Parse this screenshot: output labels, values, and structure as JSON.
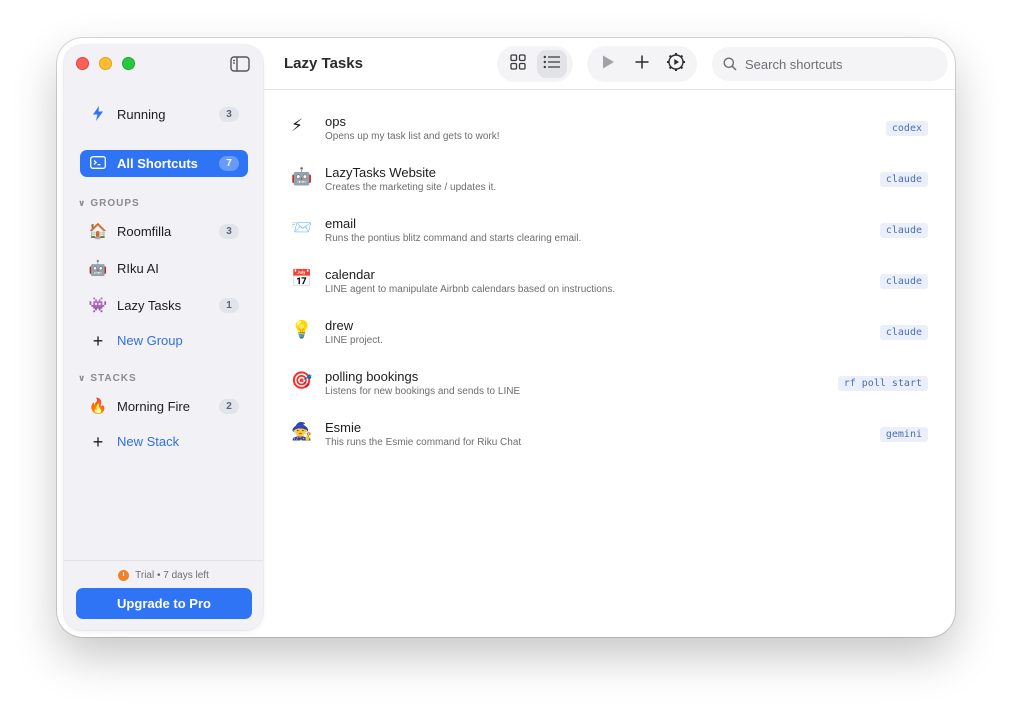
{
  "window": {
    "title": "Lazy Tasks"
  },
  "sidebar": {
    "running": {
      "label": "Running",
      "count": "3"
    },
    "all_shortcuts": {
      "label": "All Shortcuts",
      "count": "7"
    },
    "groups_header": "GROUPS",
    "groups": [
      {
        "emoji": "🏠",
        "label": "Roomfilla",
        "count": "3"
      },
      {
        "emoji": "🤖",
        "label": "RIku AI",
        "count": ""
      },
      {
        "emoji": "👾",
        "label": "Lazy Tasks",
        "count": "1"
      }
    ],
    "new_group": "New Group",
    "stacks_header": "STACKS",
    "stacks": [
      {
        "emoji": "🔥",
        "label": "Morning Fire",
        "count": "2"
      }
    ],
    "new_stack": "New Stack",
    "trial": "Trial • 7 days left",
    "upgrade": "Upgrade to Pro"
  },
  "toolbar": {
    "search_placeholder": "Search shortcuts",
    "view_mode": "list"
  },
  "shortcuts": [
    {
      "emoji": "⚡",
      "name": "ops",
      "desc": "Opens up my task list and gets to work!",
      "tag": "codex"
    },
    {
      "emoji": "🤖",
      "name": "LazyTasks Website",
      "desc": "Creates the marketing site / updates it.",
      "tag": "claude"
    },
    {
      "emoji": "📨",
      "name": "email",
      "desc": "Runs the pontius blitz command and starts clearing email.",
      "tag": "claude"
    },
    {
      "emoji": "📅",
      "name": "calendar",
      "desc": "LINE agent to manipulate Airbnb calendars based on instructions.",
      "tag": "claude"
    },
    {
      "emoji": "💡",
      "name": "drew",
      "desc": "LINE project.",
      "tag": "claude"
    },
    {
      "emoji": "🎯",
      "name": "polling bookings",
      "desc": "Listens for new bookings and sends to LINE",
      "tag": "rf poll start"
    },
    {
      "emoji": "🧙",
      "name": "Esmie",
      "desc": "This runs the Esmie command for Riku Chat",
      "tag": "gemini"
    }
  ],
  "colors": {
    "accent": "#2f74f4",
    "tag_bg": "#eaeff9",
    "tag_fg": "#4a6fb5"
  }
}
